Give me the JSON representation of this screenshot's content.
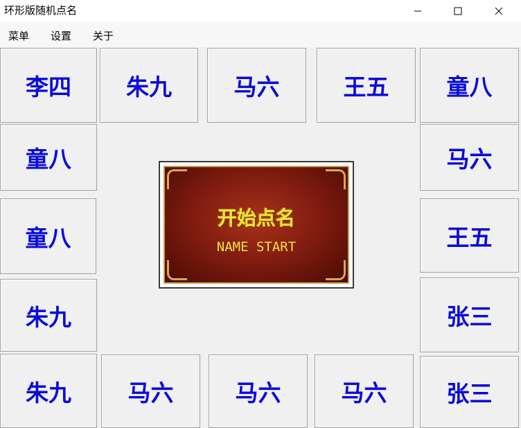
{
  "window": {
    "title": "环形版随机点名",
    "minimize_icon": "minimize-icon",
    "maximize_icon": "maximize-icon",
    "close_icon": "close-icon"
  },
  "menu": {
    "items": [
      "菜单",
      "设置",
      "关于"
    ]
  },
  "ring": {
    "name_color": "#0a0adc",
    "top_row": [
      "李四",
      "朱九",
      "马六",
      "王五",
      "童八"
    ],
    "left_column": [
      "童八",
      "童八",
      "朱九"
    ],
    "right_column": [
      "马六",
      "王五",
      "张三"
    ],
    "bottom_row": [
      "朱九",
      "马六",
      "马六",
      "马六",
      "张三"
    ]
  },
  "start_button": {
    "title": "开始点名",
    "subtitle": "NAME START"
  }
}
